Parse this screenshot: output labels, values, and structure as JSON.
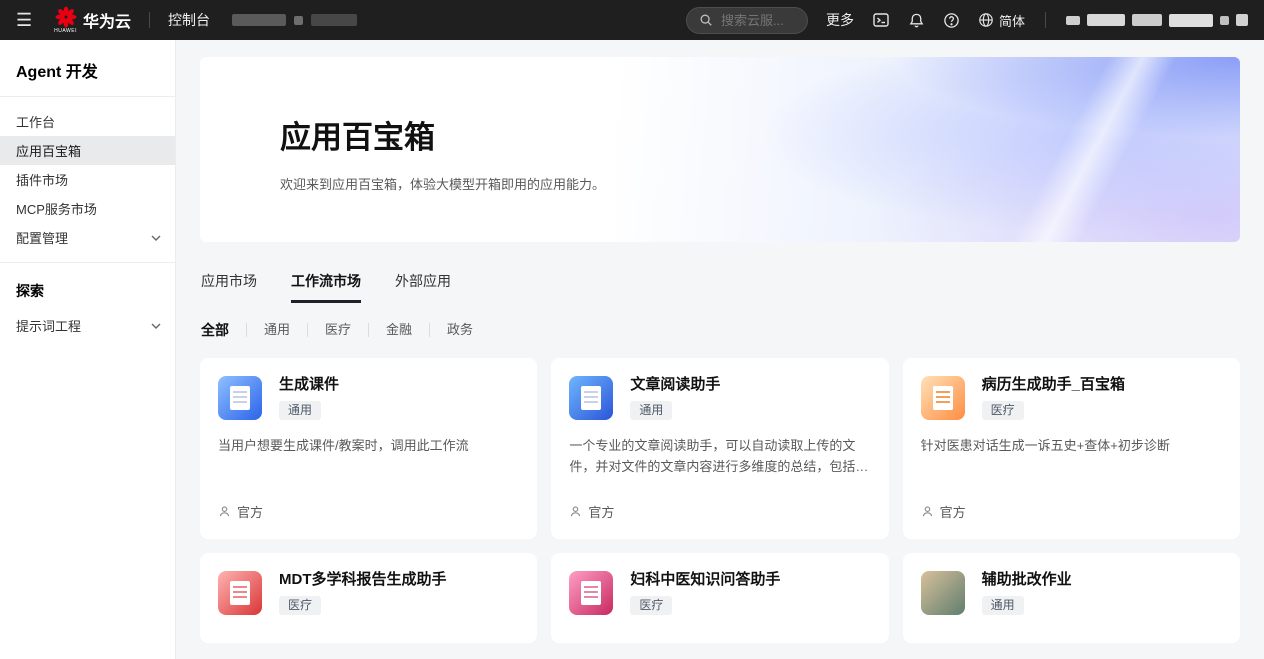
{
  "topbar": {
    "brand": "华为云",
    "brand_caption": "HUAWEI",
    "console": "控制台",
    "search_placeholder": "搜索云服...",
    "more": "更多",
    "language": "简体"
  },
  "icons": {
    "menu": "☰",
    "search": "magnifier",
    "console_window": "terminal-window",
    "notifications": "bell",
    "help": "question-circle",
    "language": "globe",
    "chevron": "chevron-down",
    "owner": "person"
  },
  "sidebar": {
    "title": "Agent 开发",
    "items": [
      {
        "label": "工作台",
        "active": false,
        "expandable": false
      },
      {
        "label": "应用百宝箱",
        "active": true,
        "expandable": false
      },
      {
        "label": "插件市场",
        "active": false,
        "expandable": false
      },
      {
        "label": "MCP服务市场",
        "active": false,
        "expandable": false
      },
      {
        "label": "配置管理",
        "active": false,
        "expandable": true
      }
    ],
    "explore_title": "探索",
    "explore_items": [
      {
        "label": "提示词工程",
        "active": false,
        "expandable": true
      }
    ]
  },
  "hero": {
    "title": "应用百宝箱",
    "subtitle": "欢迎来到应用百宝箱，体验大模型开箱即用的应用能力。"
  },
  "tabs": [
    {
      "label": "应用市场",
      "active": false
    },
    {
      "label": "工作流市场",
      "active": true
    },
    {
      "label": "外部应用",
      "active": false
    }
  ],
  "filters": [
    {
      "label": "全部",
      "active": true
    },
    {
      "label": "通用",
      "active": false
    },
    {
      "label": "医疗",
      "active": false
    },
    {
      "label": "金融",
      "active": false
    },
    {
      "label": "政务",
      "active": false
    }
  ],
  "cards": [
    {
      "title": "生成课件",
      "tag": "通用",
      "description": "当用户想要生成课件/教案时，调用此工作流",
      "owner": "官方"
    },
    {
      "title": "文章阅读助手",
      "tag": "通用",
      "description": "一个专业的文章阅读助手，可以自动读取上传的文件，并对文件的文章内容进行多维度的总结，包括文章主题、事件…",
      "owner": "官方"
    },
    {
      "title": "病历生成助手_百宝箱",
      "tag": "医疗",
      "description": "针对医患对话生成一诉五史+查体+初步诊断",
      "owner": "官方"
    },
    {
      "title": "MDT多学科报告生成助手",
      "tag": "医疗"
    },
    {
      "title": "妇科中医知识问答助手",
      "tag": "医疗"
    },
    {
      "title": "辅助批改作业",
      "tag": "通用"
    }
  ],
  "colors": {
    "topbar_bg": "#1f1f1f",
    "brand_red": "#e60012",
    "active_tab_underline": "#1f2329",
    "page_bg": "#f5f6f8"
  }
}
